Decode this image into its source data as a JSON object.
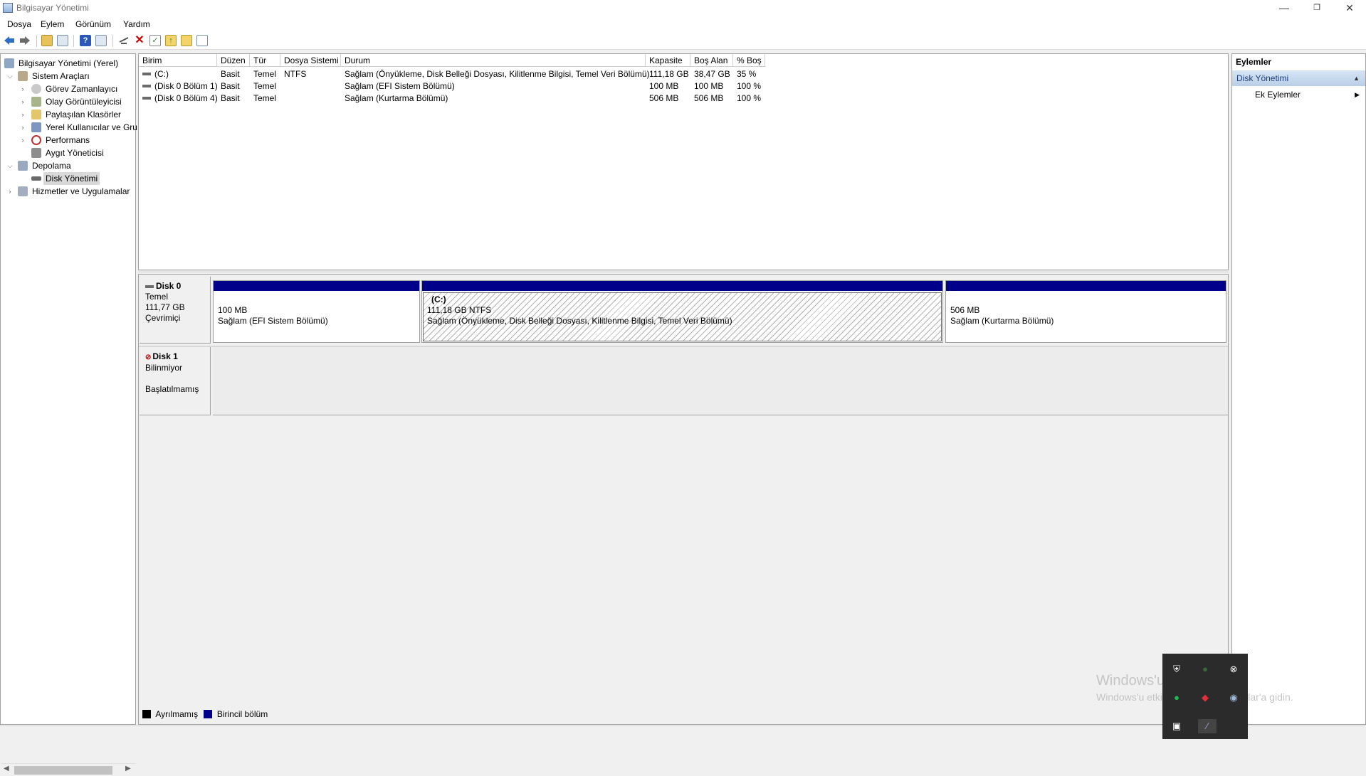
{
  "window": {
    "title": "Bilgisayar Yönetimi",
    "minimize": "—",
    "restore": "❐",
    "close": "✕"
  },
  "menu": [
    "Dosya",
    "Eylem",
    "Görünüm",
    "Yardım"
  ],
  "tree": {
    "root": "Bilgisayar Yönetimi (Yerel)",
    "system_tools": "Sistem Araçları",
    "task_scheduler": "Görev Zamanlayıcı",
    "event_viewer": "Olay Görüntüleyicisi",
    "shared_folders": "Paylaşılan Klasörler",
    "local_users": "Yerel Kullanıcılar ve Gru",
    "performance": "Performans",
    "device_manager": "Aygıt Yöneticisi",
    "storage": "Depolama",
    "disk_management": "Disk Yönetimi",
    "services_apps": "Hizmetler ve Uygulamalar"
  },
  "volumes": {
    "headers": [
      "Birim",
      "Düzen",
      "Tür",
      "Dosya Sistemi",
      "Durum",
      "Kapasite",
      "Boş Alan",
      "% Boş"
    ],
    "rows": [
      [
        "(C:)",
        "Basit",
        "Temel",
        "NTFS",
        "Sağlam (Önyükleme, Disk Belleği Dosyası, Kilitlenme Bilgisi, Temel Veri Bölümü)",
        "111,18 GB",
        "38,47 GB",
        "35 %"
      ],
      [
        "(Disk 0 Bölüm 1)",
        "Basit",
        "Temel",
        "",
        "Sağlam (EFI Sistem Bölümü)",
        "100 MB",
        "100 MB",
        "100 %"
      ],
      [
        "(Disk 0 Bölüm 4)",
        "Basit",
        "Temel",
        "",
        "Sağlam (Kurtarma Bölümü)",
        "506 MB",
        "506 MB",
        "100 %"
      ]
    ]
  },
  "disks": {
    "disk0": {
      "name": "Disk 0",
      "type": "Temel",
      "size": "111,77 GB",
      "status": "Çevrimiçi",
      "partitions": [
        {
          "line1": "100 MB",
          "line2": "Sağlam (EFI Sistem Bölümü)"
        },
        {
          "title": "(C:)",
          "line1": "111,18 GB NTFS",
          "line2": "Sağlam (Önyükleme, Disk Belleği Dosyası, Kilitlenme Bilgisi, Temel Veri Bölümü)"
        },
        {
          "line1": "506 MB",
          "line2": "Sağlam (Kurtarma Bölümü)"
        }
      ]
    },
    "disk1": {
      "name": "Disk 1",
      "type": "Bilinmiyor",
      "status": "Başlatılmamış"
    }
  },
  "legend": {
    "unallocated": "Ayrılmamış",
    "primary": "Birincil bölüm",
    "unallocated_color": "#000000",
    "primary_color": "#00008b"
  },
  "actions": {
    "header": "Eylemler",
    "section": "Disk Yönetimi",
    "more": "Ek Eylemler"
  },
  "watermark": {
    "line1": "Windows'u Etkinleştir",
    "line2": "Windows'u etkinleştirmek için Ayarlar'a gidin."
  }
}
